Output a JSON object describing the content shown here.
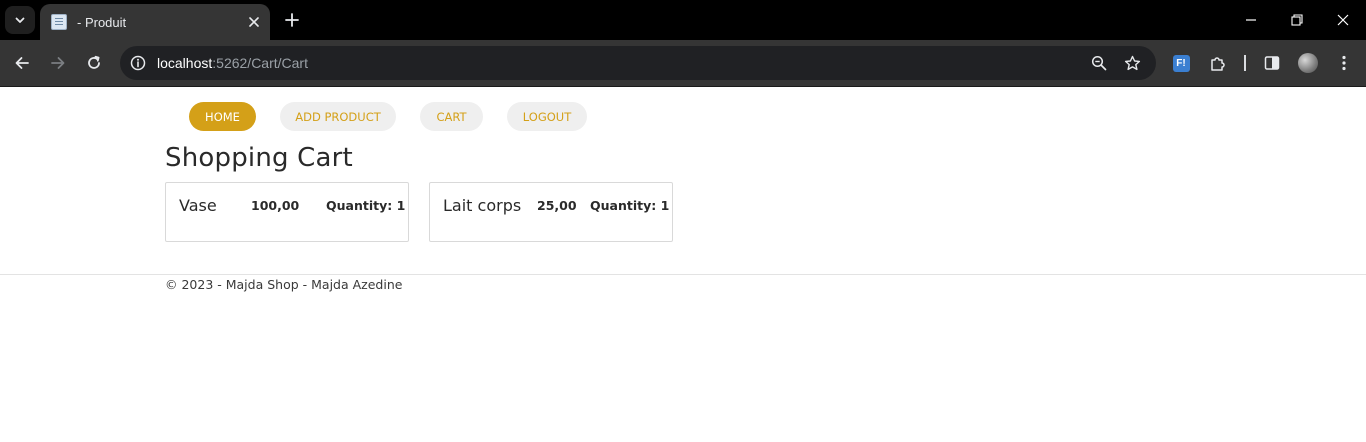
{
  "browser": {
    "tab_title": "- Produit",
    "url_host": "localhost",
    "url_path": ":5262/Cart/Cart",
    "extension_label": "F!"
  },
  "nav": {
    "items": [
      {
        "label": "HOME"
      },
      {
        "label": "ADD PRODUCT"
      },
      {
        "label": "CART"
      },
      {
        "label": "LOGOUT"
      }
    ]
  },
  "cart": {
    "title": "Shopping Cart",
    "items": [
      {
        "name": "Vase",
        "price": "100,00",
        "quantity": "Quantity: 1"
      },
      {
        "name": "Lait corps",
        "price": "25,00",
        "quantity": "Quantity: 1"
      }
    ]
  },
  "footer": {
    "text": "© 2023 - Majda Shop - Majda Azedine"
  },
  "colors": {
    "accent": "#d4a018",
    "pill_bg": "#efefef",
    "chrome_dark": "#000000",
    "toolbar": "#353535"
  }
}
